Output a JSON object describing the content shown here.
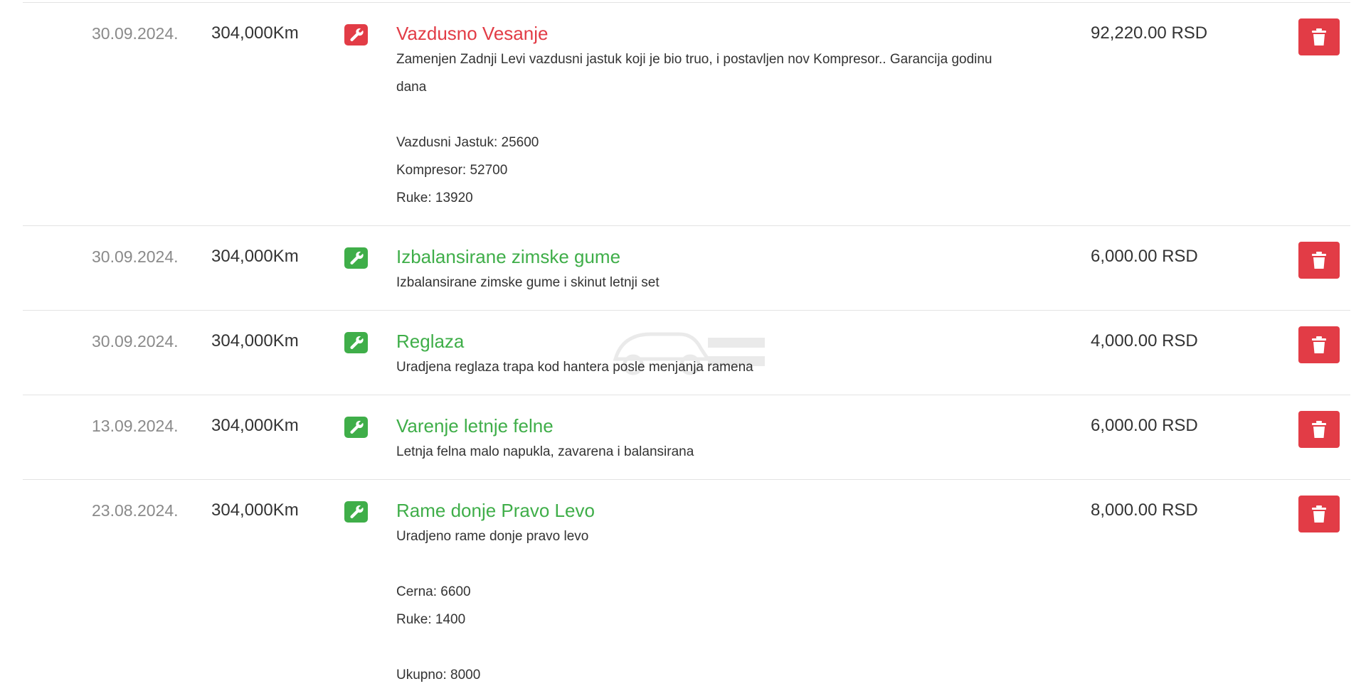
{
  "colors": {
    "red": "#e23c46",
    "green": "#3fae49",
    "delete": "#e23c46",
    "divider": "#e3e3e3",
    "muted": "#8a8a8a",
    "text": "#333333"
  },
  "icons": {
    "type": "wrench-icon",
    "delete": "trash-icon"
  },
  "entries": [
    {
      "date": "30.09.2024.",
      "mileage": "304,000Km",
      "status": "red",
      "title": "Vazdusno Vesanje",
      "lines": [
        "Zamenjen Zadnji Levi vazdusni jastuk koji je bio truo, i postavljen nov Kompresor.. Garancija godinu",
        "dana",
        "",
        "Vazdusni Jastuk: 25600",
        "Kompresor: 52700",
        "Ruke: 13920"
      ],
      "price": "92,220.00 RSD"
    },
    {
      "date": "30.09.2024.",
      "mileage": "304,000Km",
      "status": "green",
      "title": "Izbalansirane zimske gume",
      "lines": [
        "Izbalansirane zimske gume i skinut letnji set"
      ],
      "price": "6,000.00 RSD"
    },
    {
      "date": "30.09.2024.",
      "mileage": "304,000Km",
      "status": "green",
      "title": "Reglaza",
      "lines": [
        "Uradjena reglaza trapa kod hantera posle menjanja ramena"
      ],
      "price": "4,000.00 RSD"
    },
    {
      "date": "13.09.2024.",
      "mileage": "304,000Km",
      "status": "green",
      "title": "Varenje letnje felne",
      "lines": [
        "Letnja felna malo napukla, zavarena i balansirana"
      ],
      "price": "6,000.00 RSD"
    },
    {
      "date": "23.08.2024.",
      "mileage": "304,000Km",
      "status": "green",
      "title": "Rame donje Pravo Levo",
      "lines": [
        "Uradjeno rame donje pravo levo",
        "",
        "Cerna: 6600",
        "Ruke: 1400",
        "",
        "Ukupno: 8000"
      ],
      "price": "8,000.00 RSD"
    }
  ]
}
